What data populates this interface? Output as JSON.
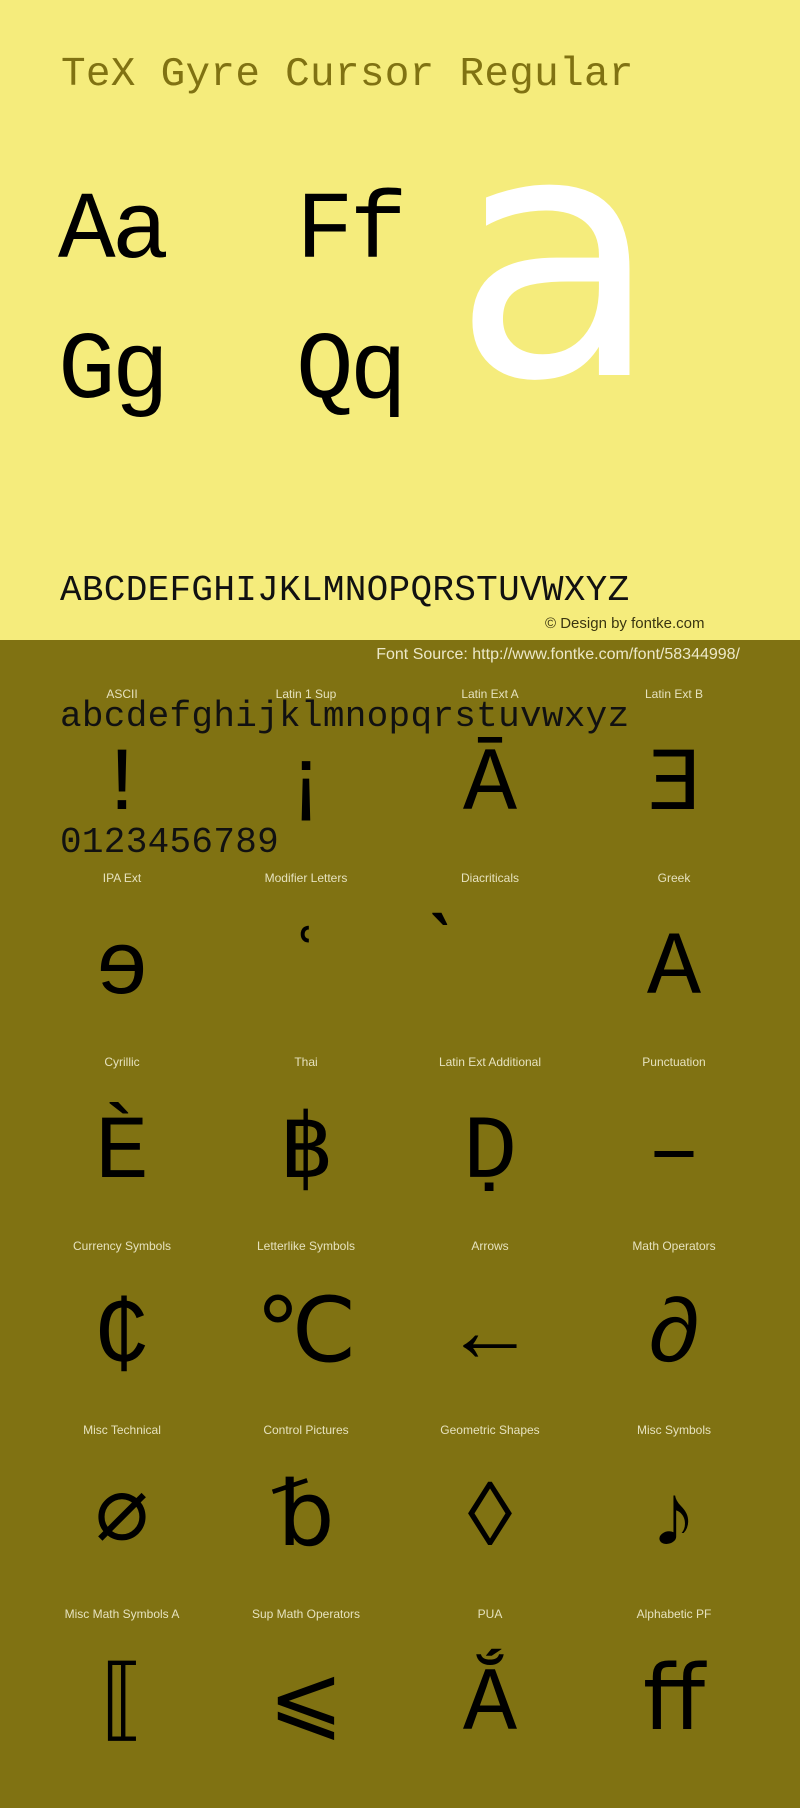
{
  "header": {
    "title": "TeX Gyre Cursor Regular"
  },
  "showcase": {
    "pairs": [
      "Aa",
      "Ff",
      "Gg",
      "Qq"
    ],
    "hero_glyph": "a"
  },
  "charset": {
    "uppercase": "ABCDEFGHIJKLMNOPQRSTUVWXYZ",
    "lowercase": "abcdefghijklmnopqrstuvwxyz",
    "digits": "0123456789"
  },
  "credit": "© Design by fontke.com",
  "source": "Font Source: http://www.fontke.com/font/58344998/",
  "colors": {
    "top_background": "#F5EC7C",
    "bottom_background": "#807212",
    "title": "#807212",
    "hero_glyph": "#FFFFFF",
    "glyph": "#000000"
  },
  "blocks": [
    {
      "label": "ASCII",
      "glyph": "!"
    },
    {
      "label": "Latin 1 Sup",
      "glyph": "¡"
    },
    {
      "label": "Latin Ext A",
      "glyph": "Ā"
    },
    {
      "label": "Latin Ext B",
      "glyph": "Ǝ"
    },
    {
      "label": "IPA Ext",
      "glyph": "ɘ"
    },
    {
      "label": "Modifier Letters",
      "glyph": "ʿ"
    },
    {
      "label": "Diacriticals",
      "glyph": "̀"
    },
    {
      "label": "Greek",
      "glyph": "Α"
    },
    {
      "label": "Cyrillic",
      "glyph": "Ѐ"
    },
    {
      "label": "Thai",
      "glyph": "฿"
    },
    {
      "label": "Latin Ext Additional",
      "glyph": "Ḍ"
    },
    {
      "label": "Punctuation",
      "glyph": "–"
    },
    {
      "label": "Currency Symbols",
      "glyph": "₵"
    },
    {
      "label": "Letterlike Symbols",
      "glyph": "℃"
    },
    {
      "label": "Arrows",
      "glyph": "←"
    },
    {
      "label": "Math Operators",
      "glyph": "∂"
    },
    {
      "label": "Misc Technical",
      "glyph": "⌀"
    },
    {
      "label": "Control Pictures",
      "glyph": "␢"
    },
    {
      "label": "Geometric Shapes",
      "glyph": "◊"
    },
    {
      "label": "Misc Symbols",
      "glyph": "♪"
    },
    {
      "label": "Misc Math Symbols A",
      "glyph": "⟦"
    },
    {
      "label": "Sup Math Operators",
      "glyph": "⩽"
    },
    {
      "label": "PUA",
      "glyph": "Ắ"
    },
    {
      "label": "Alphabetic PF",
      "glyph": "ﬀ"
    }
  ]
}
